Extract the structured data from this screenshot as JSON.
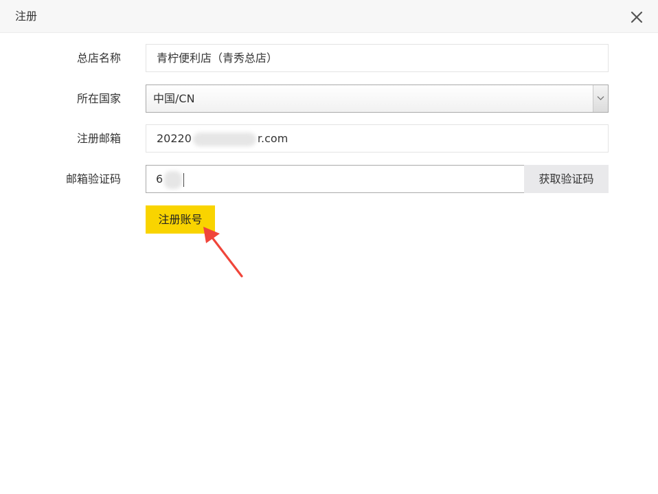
{
  "dialog": {
    "title": "注册"
  },
  "form": {
    "store_name": {
      "label": "总店名称",
      "value": "青柠便利店（青秀总店）"
    },
    "country": {
      "label": "所在国家",
      "selected": "中国/CN"
    },
    "email": {
      "label": "注册邮箱",
      "value_prefix": "20220",
      "value_suffix": "r.com"
    },
    "verify_code": {
      "label": "邮箱验证码",
      "value_prefix": "6",
      "get_code_label": "获取验证码"
    },
    "submit_label": "注册账号"
  },
  "colors": {
    "submit_bg": "#f9d400",
    "annotation_arrow": "#f0453a"
  }
}
